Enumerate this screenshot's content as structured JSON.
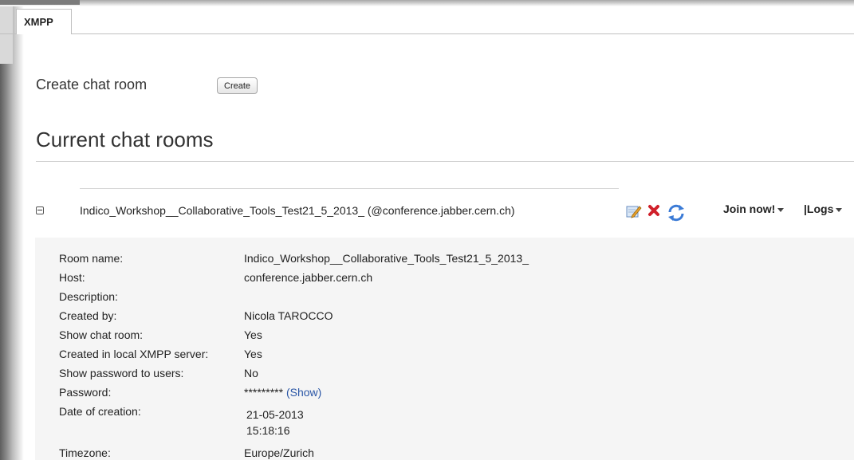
{
  "tabs": [
    {
      "label": "XMPP"
    }
  ],
  "create": {
    "label": "Create chat room",
    "button": "Create"
  },
  "section_title": "Current chat rooms",
  "room": {
    "title": "Indico_Workshop__Collaborative_Tools_Test21_5_2013_ (@conference.jabber.cern.ch)",
    "join_label": "Join now!",
    "logs_label": "Logs",
    "details": [
      {
        "label": "Room name:",
        "value": "Indico_Workshop__Collaborative_Tools_Test21_5_2013_"
      },
      {
        "label": "Host:",
        "value": "conference.jabber.cern.ch"
      },
      {
        "label": "Description:",
        "value": ""
      },
      {
        "label": "Created by:",
        "value": "Nicola TAROCCO"
      },
      {
        "label": "Show chat room:",
        "value": "Yes"
      },
      {
        "label": "Created in local XMPP server:",
        "value": "Yes"
      },
      {
        "label": "Show password to users:",
        "value": "No"
      },
      {
        "label": "Password:",
        "value": "*********",
        "link": "(Show)"
      },
      {
        "label": "Date of creation:",
        "value": "21-05-2013",
        "value2": "15:18:16"
      },
      {
        "label": "Timezone:",
        "value": "Europe/Zurich"
      }
    ]
  },
  "icons": {
    "edit": "edit-icon",
    "delete": "delete-icon",
    "refresh": "refresh-icon",
    "collapse": "collapse-icon"
  },
  "colors": {
    "link": "#2a56a6",
    "delete_red": "#d0202a",
    "refresh_blue": "#3b7bd6"
  }
}
